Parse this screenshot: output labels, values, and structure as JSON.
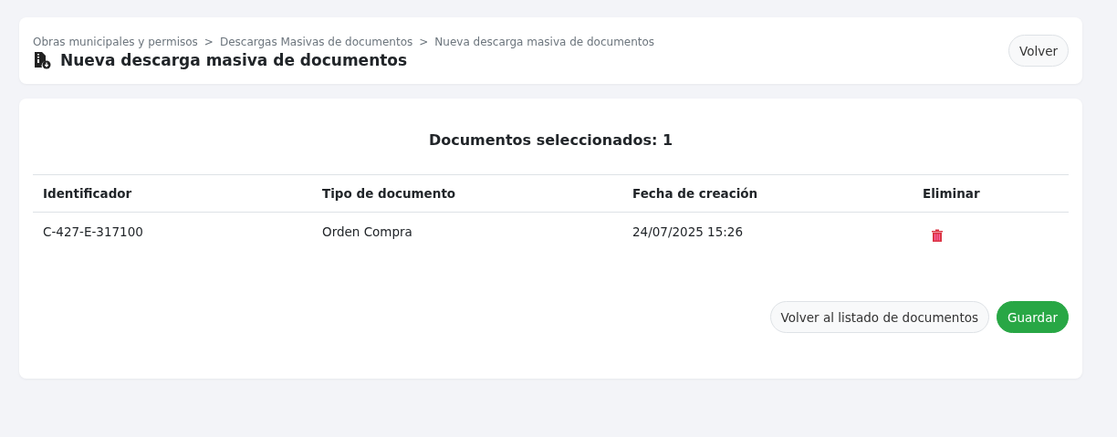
{
  "breadcrumb": [
    {
      "label": "Obras municipales y permisos"
    },
    {
      "separator": ">",
      "label": "Descargas Masivas de documentos"
    },
    {
      "separator": ">",
      "label": "Nueva descarga masiva de documentos"
    }
  ],
  "page_title": "Nueva descarga masiva de documentos",
  "back_button": "Volver",
  "summary": "Documentos seleccionados: 1",
  "table": {
    "columns": [
      "Identificador",
      "Tipo de documento",
      "Fecha de creación",
      "Eliminar"
    ],
    "rows": [
      {
        "cells": [
          "C-427-E-317100",
          "Orden Compra",
          "24/07/2025 15:26"
        ]
      }
    ]
  },
  "actions": [
    {
      "kind": "secondary",
      "label": "Volver al listado de documentos"
    },
    {
      "kind": "primary",
      "label": "Guardar"
    }
  ]
}
